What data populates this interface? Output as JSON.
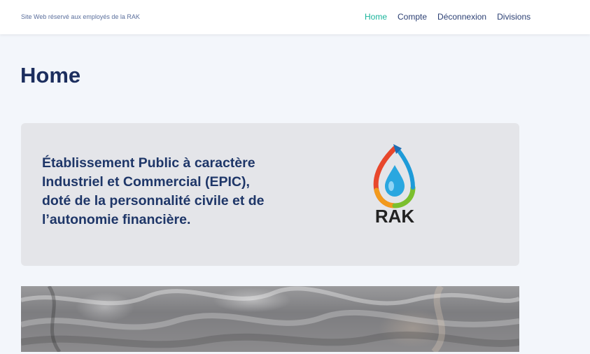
{
  "header": {
    "tagline": "Site Web réservé aux employés de la RAK",
    "nav": [
      {
        "label": "Home",
        "active": true
      },
      {
        "label": "Compte",
        "active": false
      },
      {
        "label": "Déconnexion",
        "active": false
      },
      {
        "label": "Divisions",
        "active": false
      }
    ]
  },
  "main": {
    "title": "Home",
    "hero": {
      "text": "Établissement Public à caractère Industriel et Commercial (EPIC), doté de la personnalité civile et de l’autonomie financière.",
      "logo_text": "RAK"
    },
    "banner": {
      "image": "water-surface-photo"
    }
  },
  "colors": {
    "accent": "#19b49b",
    "navy": "#1c2e5e",
    "card_bg": "#e4e5e9",
    "page_bg": "#f3f6fb"
  }
}
